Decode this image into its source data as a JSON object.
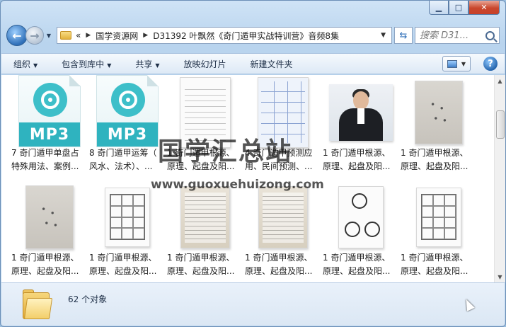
{
  "breadcrumb": {
    "overflow": "«",
    "items": [
      "国学资源网",
      "D31392 叶飘然《奇门遁甲实战特训营》音频8集"
    ]
  },
  "search": {
    "placeholder": "搜索 D31..."
  },
  "toolbar": {
    "organize": "组织",
    "include_library": "包含到库中",
    "share": "共享",
    "slideshow": "放映幻灯片",
    "new_folder": "新建文件夹"
  },
  "files": [
    {
      "type": "mp3",
      "thumb_text": "MP3",
      "line1": "7 奇门遁甲单盘占",
      "line2": "特殊用法、案例..."
    },
    {
      "type": "mp3",
      "thumb_text": "MP3",
      "line1": "8 奇门遁甲运筹（",
      "line2": "风水、法术）、..."
    },
    {
      "type": "doc-white",
      "line1": "1 奇门遁甲根源、",
      "line2": "原理、起盘及阳..."
    },
    {
      "type": "doc-blue",
      "line1": "4 奇门遁甲预测应",
      "line2": "用、民间预测、..."
    },
    {
      "type": "photo",
      "line1": "1 奇门遁甲根源、",
      "line2": "原理、起盘及阳..."
    },
    {
      "type": "doc-gray",
      "line1": "1 奇门遁甲根源、",
      "line2": "原理、起盘及阳..."
    },
    {
      "type": "doc-gray",
      "line1": "1 奇门遁甲根源、",
      "line2": "原理、起盘及阳..."
    },
    {
      "type": "doc-grid",
      "line1": "1 奇门遁甲根源、",
      "line2": "原理、起盘及阳..."
    },
    {
      "type": "doc-paper",
      "line1": "1 奇门遁甲根源、",
      "line2": "原理、起盘及阳..."
    },
    {
      "type": "doc-paper",
      "line1": "1 奇门遁甲根源、",
      "line2": "原理、起盘及阳..."
    },
    {
      "type": "doc-bagua",
      "line1": "1 奇门遁甲根源、",
      "line2": "原理、起盘及阳..."
    },
    {
      "type": "doc-grid",
      "line1": "1 奇门遁甲根源、",
      "line2": "原理、起盘及阳..."
    }
  ],
  "watermark": {
    "cn": "国学汇总站",
    "url": "www.guoxuehuizong.com"
  },
  "status": {
    "count": "62 个对象"
  },
  "icons": {
    "back": "back-arrow-icon",
    "forward": "forward-arrow-icon",
    "folder": "folder-icon",
    "search": "search-icon",
    "refresh": "refresh-icon",
    "view": "view-icon",
    "help": "help-icon"
  }
}
